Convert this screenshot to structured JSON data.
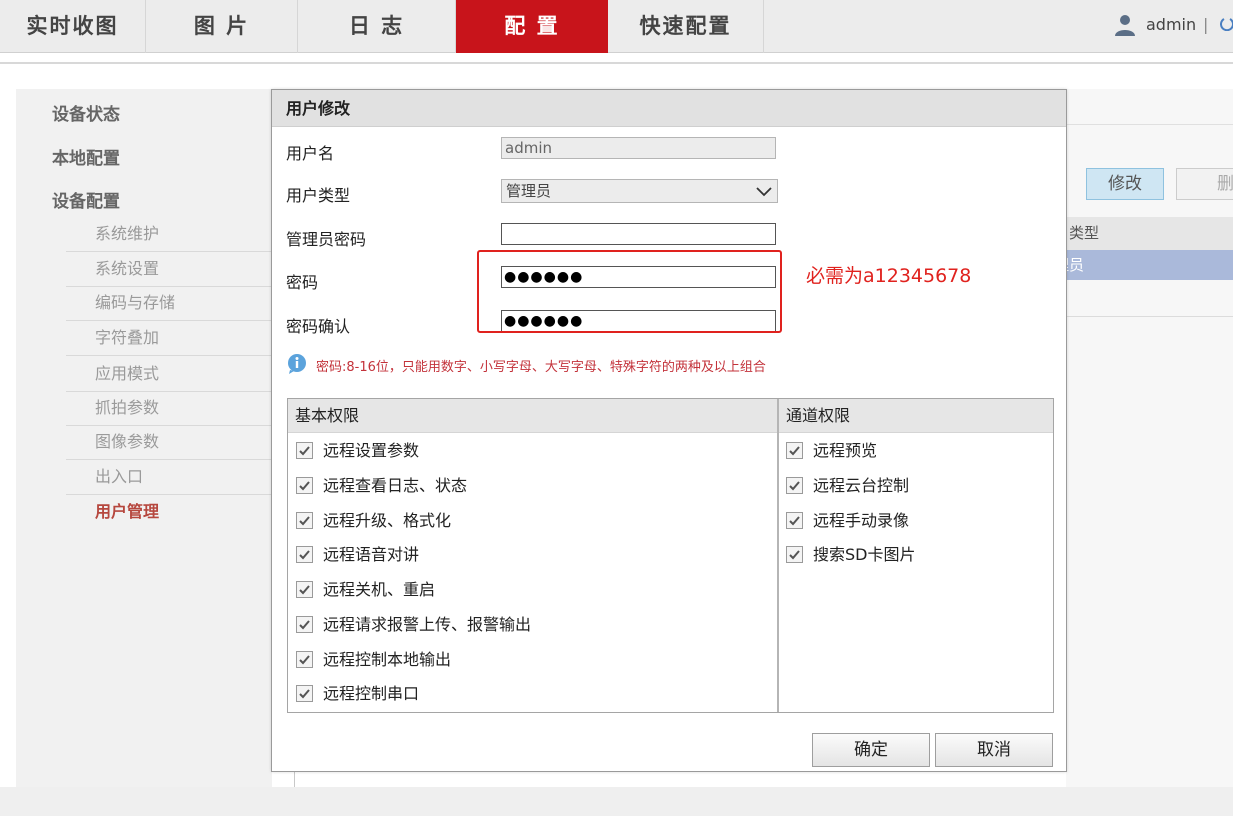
{
  "nav": {
    "tabs": [
      {
        "label": "实时收图"
      },
      {
        "label": "图 片"
      },
      {
        "label": "日 志"
      },
      {
        "label": "配 置"
      },
      {
        "label": "快速配置"
      }
    ],
    "user": "admin",
    "separator": "|"
  },
  "sidebar": {
    "groups": [
      {
        "label": "设备状态"
      },
      {
        "label": "本地配置"
      },
      {
        "label": "设备配置"
      }
    ],
    "items": [
      {
        "label": "系统维护"
      },
      {
        "label": "系统设置"
      },
      {
        "label": "编码与存储"
      },
      {
        "label": "字符叠加"
      },
      {
        "label": "应用模式"
      },
      {
        "label": "抓拍参数"
      },
      {
        "label": "图像参数"
      },
      {
        "label": "出入口"
      },
      {
        "label": "用户管理"
      }
    ]
  },
  "background": {
    "modify_button": "修改",
    "delete_button": "删",
    "column_header": "户类型",
    "row_value": "理员"
  },
  "dialog": {
    "title": "用户修改",
    "fields": {
      "username_label": "用户名",
      "username_value": "admin",
      "usertype_label": "用户类型",
      "usertype_value": "管理员",
      "admin_password_label": "管理员密码",
      "admin_password_value": "",
      "password_label": "密码",
      "password_value": "●●●●●●",
      "confirm_label": "密码确认",
      "confirm_value": "●●●●●●"
    },
    "annotation": "必需为a12345678",
    "hint": "密码:8-16位，只能用数字、小写字母、大写字母、特殊字符的两种及以上组合",
    "basic_permissions": {
      "header": "基本权限",
      "items": [
        {
          "label": "远程设置参数",
          "checked": true
        },
        {
          "label": "远程查看日志、状态",
          "checked": true
        },
        {
          "label": "远程升级、格式化",
          "checked": true
        },
        {
          "label": "远程语音对讲",
          "checked": true
        },
        {
          "label": "远程关机、重启",
          "checked": true
        },
        {
          "label": "远程请求报警上传、报警输出",
          "checked": true
        },
        {
          "label": "远程控制本地输出",
          "checked": true
        },
        {
          "label": "远程控制串口",
          "checked": true
        }
      ]
    },
    "channel_permissions": {
      "header": "通道权限",
      "items": [
        {
          "label": "远程预览",
          "checked": true
        },
        {
          "label": "远程云台控制",
          "checked": true
        },
        {
          "label": "远程手动录像",
          "checked": true
        },
        {
          "label": "搜索SD卡图片",
          "checked": true
        }
      ]
    },
    "ok_button": "确定",
    "cancel_button": "取消"
  },
  "colors": {
    "active_tab": "#c8141b",
    "annotation_red": "#e0221e",
    "hint_text": "#c3323a",
    "active_sidebar": "#b6473e"
  }
}
